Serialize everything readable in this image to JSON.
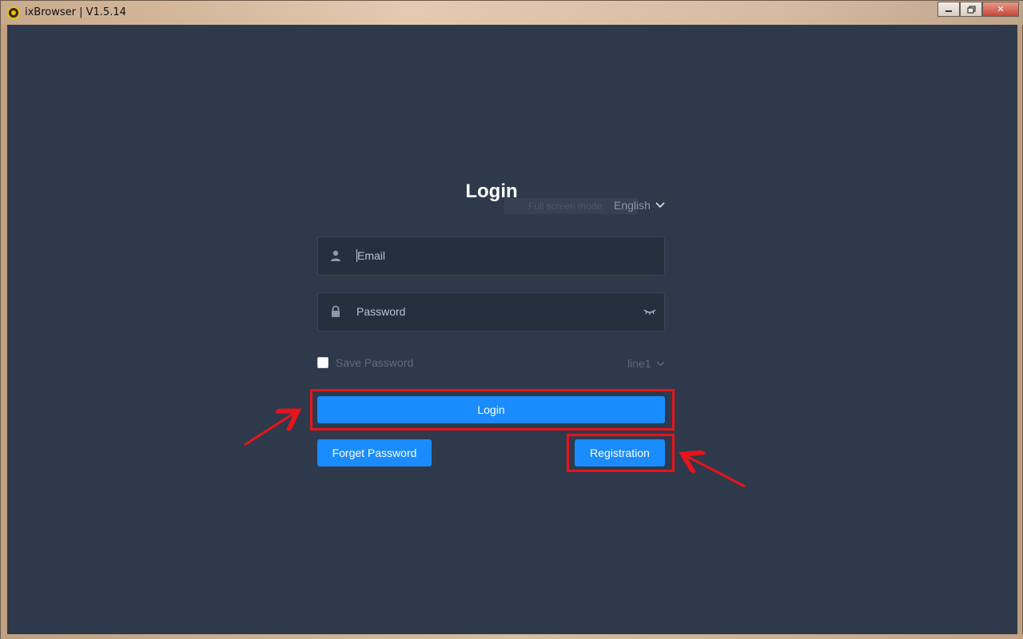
{
  "window": {
    "title": "ixBrowser | V1.5.14",
    "controls": {
      "minimize": "▭",
      "maximize": "▢",
      "close": "✕"
    }
  },
  "login": {
    "title": "Login",
    "tooltip_ghost": "Full screen mode",
    "language": "English",
    "email": {
      "placeholder": "Email",
      "icon": "user-icon"
    },
    "password": {
      "placeholder": "Password",
      "icon": "lock-icon",
      "toggle_icon": "eye-closed-icon"
    },
    "save_password_label": "Save Password",
    "save_password_checked": false,
    "line_select": "line1",
    "buttons": {
      "login": "Login",
      "forget_password": "Forget Password",
      "registration": "Registration"
    }
  },
  "colors": {
    "background": "#2e3a4b",
    "input_bg": "#252f3d",
    "primary": "#1a8cff",
    "highlight": "#e8141b"
  }
}
